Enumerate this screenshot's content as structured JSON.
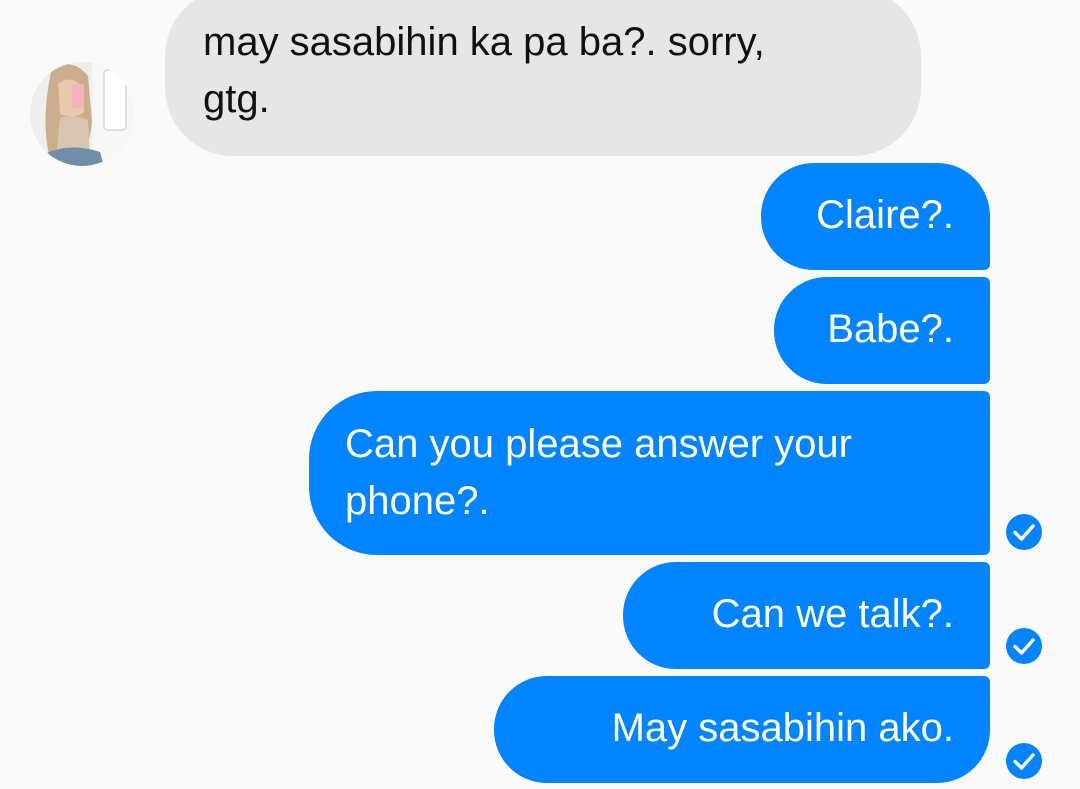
{
  "colors": {
    "background": "#fafafa",
    "incoming_bubble": "#e6e6e6",
    "outgoing_bubble": "#0084ff",
    "incoming_text": "#111111",
    "outgoing_text": "#ffffff",
    "read_receipt": "#0084ff"
  },
  "conversation": {
    "contact_avatar_icon": "profile-photo-avatar",
    "messages": [
      {
        "direction": "incoming",
        "text": "may sasabihin ka pa ba?. sorry,\ngtg.",
        "status_icon": null
      },
      {
        "direction": "outgoing",
        "text": "Claire?.",
        "status_icon": null
      },
      {
        "direction": "outgoing",
        "text": "Babe?.",
        "status_icon": null
      },
      {
        "direction": "outgoing",
        "text": "Can you please answer your\nphone?.",
        "status_icon": "check-circle-icon"
      },
      {
        "direction": "outgoing",
        "text": "Can we talk?.",
        "status_icon": "check-circle-icon"
      },
      {
        "direction": "outgoing",
        "text": "May sasabihin ako.",
        "status_icon": "check-circle-icon"
      }
    ]
  }
}
